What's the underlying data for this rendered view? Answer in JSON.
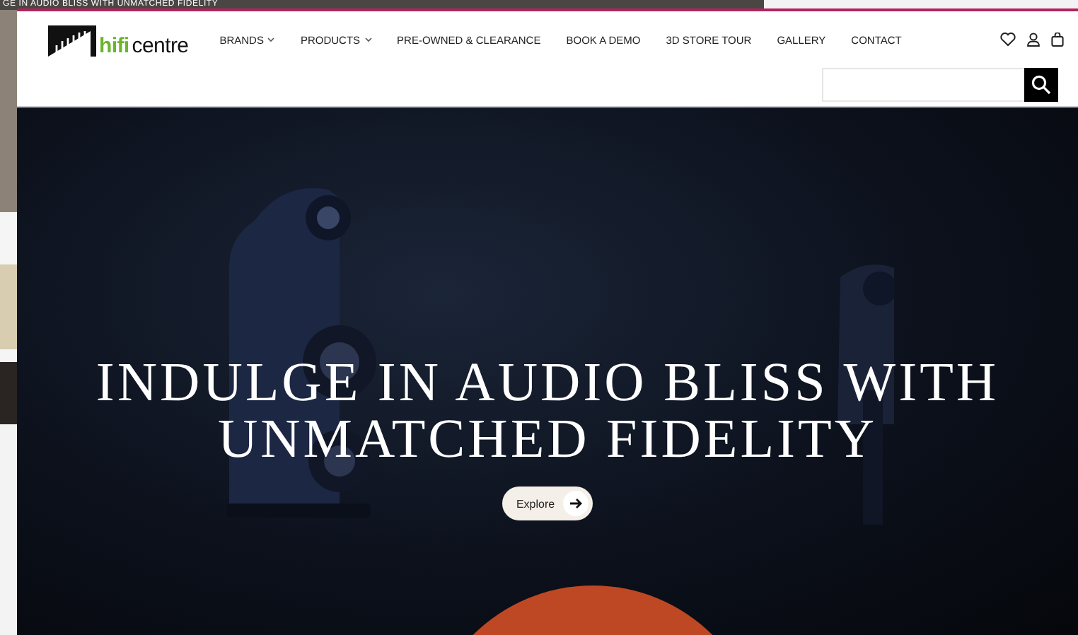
{
  "background_window": {
    "headline": "GE IN AUDIO BLISS WITH UNMATCHED FIDELITY"
  },
  "logo": {
    "brand": "hifi",
    "name": "centre"
  },
  "nav": [
    {
      "label": "BRANDS",
      "has_dropdown": true
    },
    {
      "label": "PRODUCTS",
      "has_dropdown": true
    },
    {
      "label": "PRE-OWNED & CLEARANCE",
      "has_dropdown": false
    },
    {
      "label": "BOOK A DEMO",
      "has_dropdown": false
    },
    {
      "label": "3D STORE TOUR",
      "has_dropdown": false
    },
    {
      "label": "GALLERY",
      "has_dropdown": false
    },
    {
      "label": "CONTACT",
      "has_dropdown": false
    }
  ],
  "hero": {
    "title": "INDULGE IN AUDIO BLISS WITH UNMATCHED FIDELITY",
    "button": "Explore"
  }
}
